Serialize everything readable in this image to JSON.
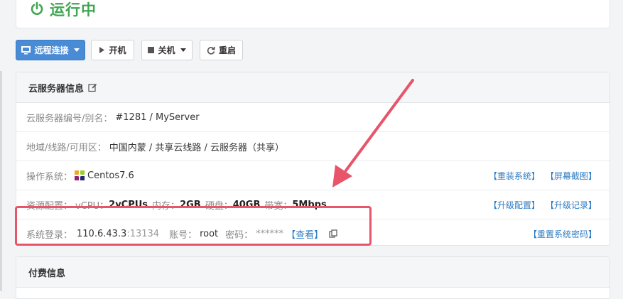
{
  "status": {
    "label": "运行中"
  },
  "toolbar": {
    "remote_label": "远程连接",
    "start_label": "开机",
    "shutdown_label": "关机",
    "restart_label": "重启"
  },
  "server_info": {
    "title": "云服务器信息",
    "rows": {
      "id": {
        "label": "云服务器编号/别名：",
        "value": "#1281 / MyServer"
      },
      "region": {
        "label": "地域/线路/可用区：",
        "value": "中国内蒙 / 共享云线路 / 云服务器（共享）"
      },
      "os": {
        "label": "操作系统：",
        "value": "Centos7.6",
        "actions": [
          "【重装系统】",
          "【屏幕截图】"
        ]
      },
      "config": {
        "label": "资源配置：",
        "vcpu_label": "vCPU：",
        "vcpu_value": "2vCPUs",
        "mem_label": "内存：",
        "mem_value": "2GB",
        "disk_label": "硬盘：",
        "disk_value": "40GB",
        "bw_label": "带宽：",
        "bw_value": "5Mbps",
        "actions": [
          "【升级配置】",
          "【升级记录】"
        ]
      },
      "login": {
        "label": "系统登录：",
        "ip": "110.6.43.3",
        "port": ":13134",
        "account_label": "账号：",
        "account_value": "root",
        "password_label": "密码：",
        "password_value": "******",
        "view_link": "【查看】",
        "reset_link": "【重置系统密码】"
      }
    }
  },
  "billing": {
    "title": "付费信息"
  },
  "colors": {
    "status_green": "#3fa652",
    "primary_blue": "#4a8bd6",
    "link_blue": "#2f7cc4",
    "annotation_red": "#e8546a"
  }
}
